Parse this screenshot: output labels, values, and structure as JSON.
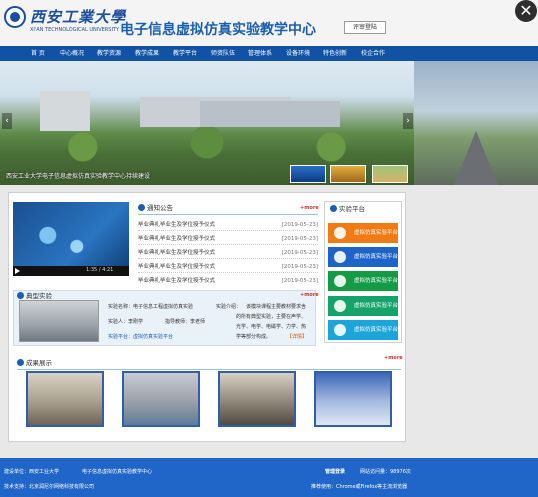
{
  "header": {
    "univ_cn": "西安工業大學",
    "univ_en": "XI'AN TECHNOLOGICAL UNIVERSITY",
    "center_name": "电子信息虚拟仿真实验教学中心",
    "review_button": "评审登陆",
    "close_glyph": "✕"
  },
  "nav": [
    "首 页",
    "中心概况",
    "教学资源",
    "教学成果",
    "教学平台",
    "师资队伍",
    "管理体系",
    "设备环境",
    "特色创新",
    "校企合作"
  ],
  "banner": {
    "caption": "西安工业大学电子信息虚拟仿真实验教学中心持续建设",
    "prev": "‹",
    "next": "›"
  },
  "video": {
    "time": "1:35 / 4:21"
  },
  "notice": {
    "title": "通知公告",
    "more": "+more",
    "items": [
      {
        "title": "毕业典礼毕业生及学位授予仪式",
        "date": "[2019-05-23]"
      },
      {
        "title": "毕业典礼毕业生及学位授予仪式",
        "date": "[2019-05-23]"
      },
      {
        "title": "毕业典礼毕业生及学位授予仪式",
        "date": "[2019-05-23]"
      },
      {
        "title": "毕业典礼毕业生及学位授予仪式",
        "date": "[2019-05-23]"
      },
      {
        "title": "毕业典礼毕业生及学位授予仪式",
        "date": "[2019-05-23]"
      }
    ]
  },
  "platform": {
    "title": "实验平台",
    "buttons": [
      {
        "label": "虚拟仿真实验平台",
        "color": "#f07a14"
      },
      {
        "label": "虚拟仿真实验平台",
        "color": "#1e64c8"
      },
      {
        "label": "虚拟仿真实验平台",
        "color": "#159a45"
      },
      {
        "label": "虚拟仿真实验平台",
        "color": "#16a36a"
      },
      {
        "label": "虚拟仿真实验平台",
        "color": "#1ca5d9"
      }
    ]
  },
  "typical": {
    "title": "典型实验",
    "more": "+more",
    "name_label": "实验名称：电子信息工程虚拟仿真实验",
    "person_label": "实验人：李刚学",
    "teacher_label": "指导教师：李老师",
    "platform_label": "实验平台：虚拟仿真实验平台",
    "intro_label": "实验介绍：",
    "intro_text": "该模块课程主要教材要求含",
    "intro_line2": "的所有典型实验，主要在声学、",
    "intro_line3": "光学、电学、电磁学、力学、热",
    "intro_line4": "学等部分构成。",
    "detail": "【详情】"
  },
  "achievements": {
    "title": "成果展示",
    "more": "+more"
  },
  "footer": {
    "host": "建设单位：西安工业大学",
    "center": "电子信息虚拟仿真实验教学中心",
    "support": "技术支持：北京润尼尔网络科技有限公司",
    "admin": "管理登录",
    "visits": "网站访问量：98976次",
    "browser": "推荐使用：Chrome或Firefox等主流浏览器"
  }
}
